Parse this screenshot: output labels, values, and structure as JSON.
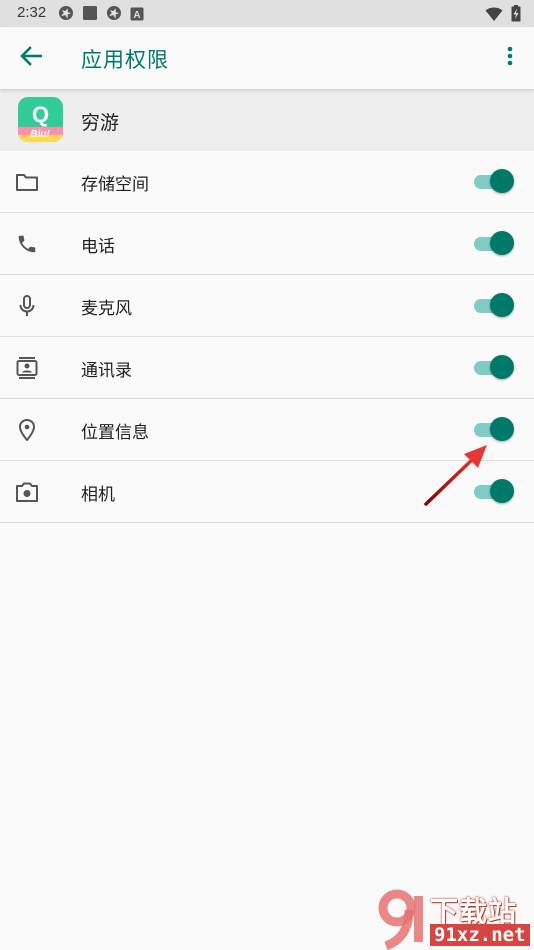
{
  "status_bar": {
    "time": "2:32",
    "left_icons": [
      "shutter-icon",
      "square-icon",
      "shutter-icon",
      "font-a-icon"
    ],
    "right_icons": [
      "wifi-icon",
      "battery-charging-icon"
    ]
  },
  "toolbar": {
    "back_icon": "arrow-left-icon",
    "title": "应用权限",
    "more_icon": "more-vert-icon"
  },
  "app": {
    "name": "穷游",
    "icon_text": "Q",
    "icon_subtext": "Biu!"
  },
  "permissions": [
    {
      "icon": "folder-icon",
      "label": "存储空间",
      "enabled": true
    },
    {
      "icon": "phone-icon",
      "label": "电话",
      "enabled": true
    },
    {
      "icon": "microphone-icon",
      "label": "麦克风",
      "enabled": true
    },
    {
      "icon": "contacts-icon",
      "label": "通讯录",
      "enabled": true
    },
    {
      "icon": "location-pin-icon",
      "label": "位置信息",
      "enabled": true
    },
    {
      "icon": "camera-icon",
      "label": "相机",
      "enabled": true
    }
  ],
  "watermark": {
    "title": "下载站",
    "url": "91xz.net"
  },
  "colors": {
    "accent": "#00796b",
    "toggle_track": "#80cbc4",
    "status_bar": "#e0e0e0",
    "app_header": "#eeeeee",
    "annotation_arrow": "#d32f2f"
  }
}
